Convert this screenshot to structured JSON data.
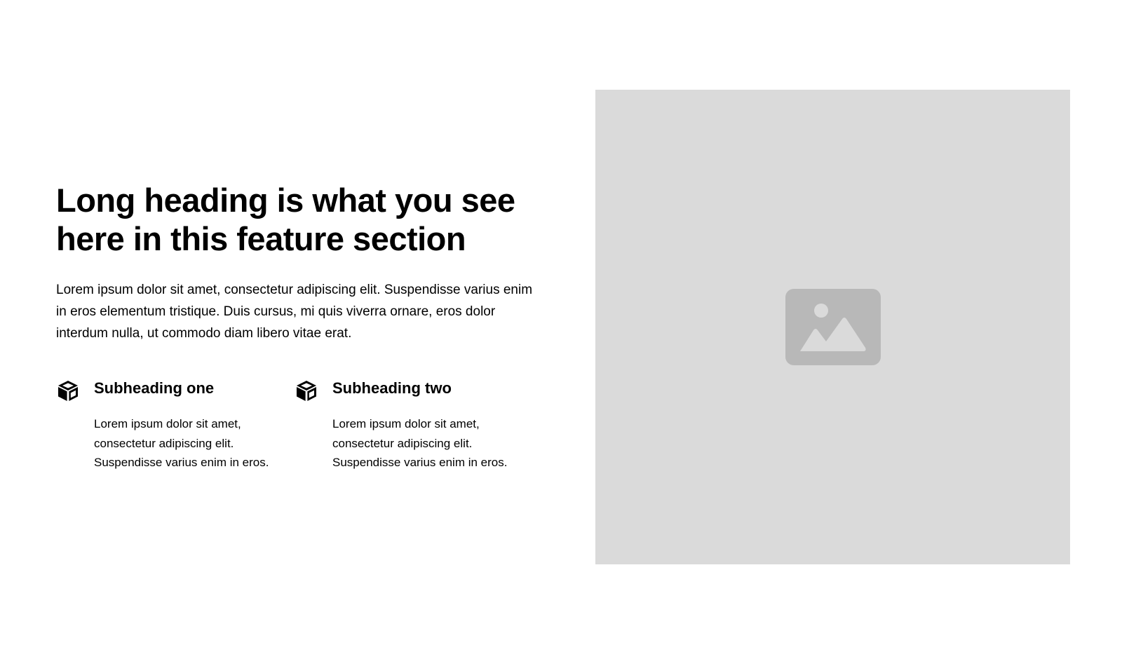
{
  "feature_section": {
    "heading": "Long heading is what you see here in this feature section",
    "intro": "Lorem ipsum dolor sit amet, consectetur adipiscing elit. Suspendisse varius enim in eros elementum tristique. Duis cursus, mi quis viverra ornare, eros dolor interdum nulla, ut commodo diam libero vitae erat.",
    "features": [
      {
        "icon": "cube-icon",
        "title": "Subheading one",
        "text": "Lorem ipsum dolor sit amet, consectetur adipiscing elit. Suspendisse varius enim in eros."
      },
      {
        "icon": "cube-icon",
        "title": "Subheading two",
        "text": "Lorem ipsum dolor sit amet, consectetur adipiscing elit. Suspendisse varius enim in eros."
      }
    ],
    "image": {
      "icon": "image-placeholder-icon"
    }
  },
  "colors": {
    "text": "#000000",
    "background": "#ffffff",
    "placeholder_bg": "#dadada",
    "placeholder_icon": "#b8b8b8"
  }
}
